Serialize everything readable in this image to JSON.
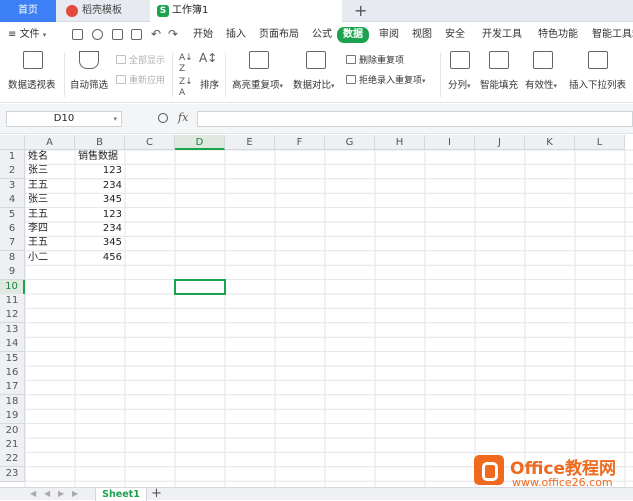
{
  "titlebar": {
    "tabs": [
      {
        "label": "首页"
      },
      {
        "label": "稻壳模板"
      },
      {
        "label": "工作簿1"
      }
    ],
    "new_tab": "+"
  },
  "menubar": {
    "file_menu": "文件",
    "menus": [
      "开始",
      "插入",
      "页面布局",
      "公式",
      "数据",
      "审阅",
      "视图",
      "安全",
      "开发工具",
      "特色功能",
      "智能工具箱"
    ],
    "active": "数据"
  },
  "ribbon": {
    "pivot_table": "数据透视表",
    "auto_filter": "自动筛选",
    "show_all": "全部显示",
    "reapply": "重新应用",
    "sort": "排序",
    "highlight_dup": "高亮重复项",
    "data_compare": "数据对比",
    "remove_dup": "删除重复项",
    "reject_dup": "拒绝录入重复项",
    "split": "分列",
    "smart_fill": "智能填充",
    "validity": "有效性",
    "insert_dropdown": "插入下拉列表"
  },
  "formula_bar": {
    "name_box": "D10",
    "fx": "fx",
    "formula": ""
  },
  "grid": {
    "columns": [
      "A",
      "B",
      "C",
      "D",
      "E",
      "F",
      "G",
      "H",
      "I",
      "J",
      "K",
      "L"
    ],
    "rows": [
      "1",
      "2",
      "3",
      "4",
      "5",
      "6",
      "7",
      "8",
      "9",
      "10",
      "11",
      "12",
      "13",
      "14",
      "15",
      "16",
      "17",
      "18",
      "19",
      "20",
      "21",
      "22",
      "23"
    ],
    "selected_column": "D",
    "selected_row": "10",
    "data": [
      {
        "a": "姓名",
        "b": "销售数据"
      },
      {
        "a": "张三",
        "b": "123"
      },
      {
        "a": "王五",
        "b": "234"
      },
      {
        "a": "张三",
        "b": "345"
      },
      {
        "a": "王五",
        "b": "123"
      },
      {
        "a": "李四",
        "b": "234"
      },
      {
        "a": "王五",
        "b": "345"
      },
      {
        "a": "小二",
        "b": "456"
      }
    ]
  },
  "sheetbar": {
    "sheet_name": "Sheet1",
    "add_sheet": "+"
  },
  "watermark": {
    "title": "Office教程网",
    "url": "www.office26.com"
  },
  "colors": {
    "accent": "#1ba34f",
    "tab_blue": "#3d7ff5",
    "watermark": "#ef6a1f"
  }
}
